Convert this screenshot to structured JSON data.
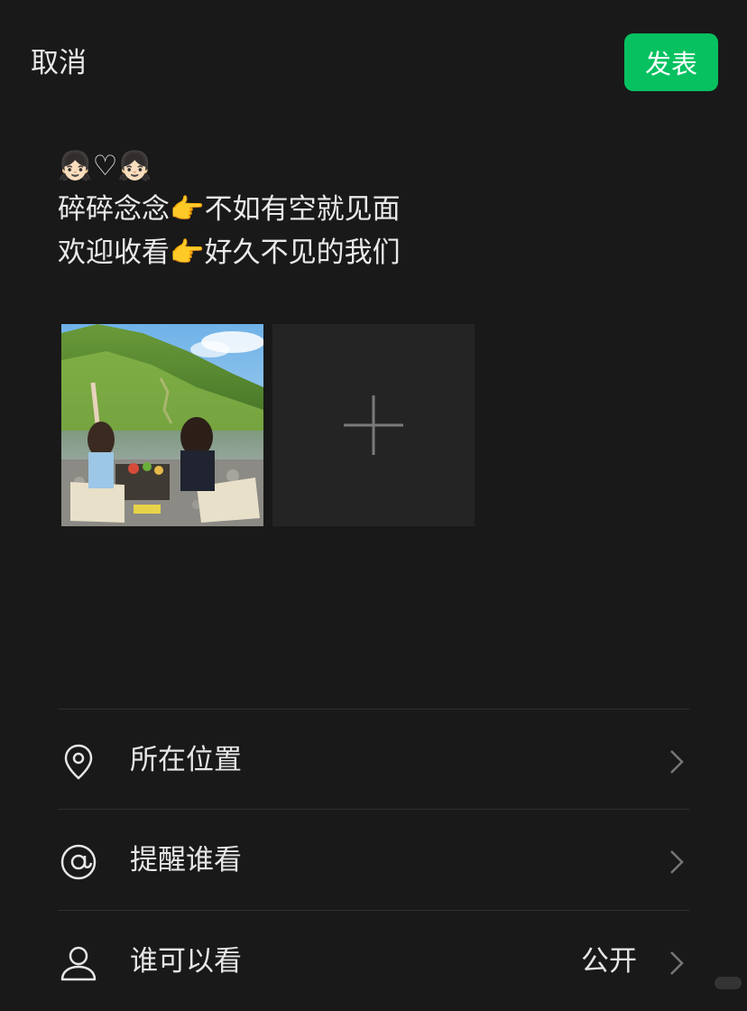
{
  "header": {
    "cancel_label": "取消",
    "publish_label": "发表"
  },
  "post": {
    "text": "👧🏻♡👧🏻\n碎碎念念👉不如有空就见面\n欢迎收看👉好久不见的我们"
  },
  "media": {
    "photo_icon": "photo-thumbnail",
    "add_icon": "plus-icon"
  },
  "options": [
    {
      "icon": "location-icon",
      "label": "所在位置",
      "value": ""
    },
    {
      "icon": "at-icon",
      "label": "提醒谁看",
      "value": ""
    },
    {
      "icon": "person-icon",
      "label": "谁可以看",
      "value": "公开"
    }
  ],
  "colors": {
    "background": "#191919",
    "accent": "#07c160",
    "tile": "#242424"
  }
}
